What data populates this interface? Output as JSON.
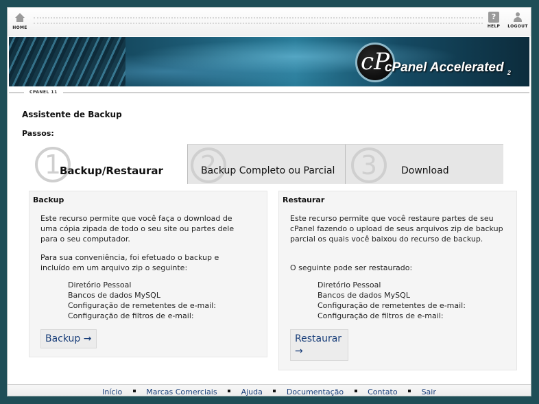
{
  "topbar": {
    "home_label": "HOME",
    "help_label": "HELP",
    "logout_label": "LOGOUT",
    "help_glyph": "?"
  },
  "banner": {
    "logo_letter": "cP",
    "logo_brand": "cPanel",
    "logo_product": "Accelerated",
    "logo_version": "2"
  },
  "strip": {
    "label": "CPANEL 11"
  },
  "page": {
    "title": "Assistente de Backup",
    "steps_label": "Passos:"
  },
  "steps": [
    {
      "number": "1",
      "label": "Backup/Restaurar"
    },
    {
      "number": "2",
      "label": "Backup Completo ou Parcial"
    },
    {
      "number": "3",
      "label": "Download"
    }
  ],
  "backup_panel": {
    "title": "Backup",
    "description": "Este recurso permite que você faça o download de uma cópia zipada de todo o seu site ou partes dele para o seu computador.",
    "note": "Para sua conveniência, foi efetuado o backup e incluído em um arquivo zip o seguinte:",
    "items": [
      "Diretório Pessoal",
      "Bancos de dados MySQL",
      "Configuração de remetentes de e-mail:",
      "Configuração de filtros de e-mail:"
    ],
    "button_label": "Backup →"
  },
  "restore_panel": {
    "title": "Restaurar",
    "description": "Este recurso permite que você restaure partes de seu cPanel fazendo o upload de seus arquivos zip de backup parcial os quais você baixou do recurso de backup.",
    "note": "O seguinte pode ser restaurado:",
    "items": [
      "Diretório Pessoal",
      "Bancos de dados MySQL",
      "Configuração de remetentes de e-mail:",
      "Configuração de filtros de e-mail:"
    ],
    "button_label": "Restaurar →"
  },
  "footer": {
    "links": [
      "Início",
      "Marcas Comerciais",
      "Ajuda",
      "Documentação",
      "Contato",
      "Sair"
    ]
  },
  "colors": {
    "link": "#1a3f7a",
    "outer_background": "#1f4e57",
    "panel_background": "#f5f5f5",
    "inactive_step": "#e6e6e6"
  }
}
